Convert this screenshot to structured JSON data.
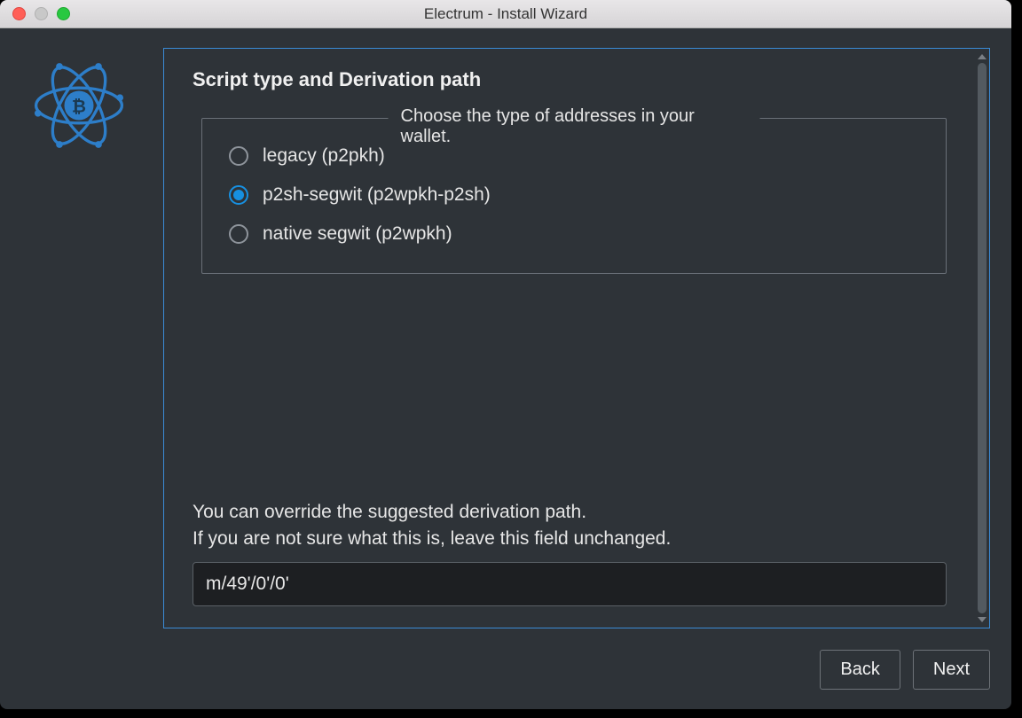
{
  "window": {
    "title": "Electrum  -  Install Wizard"
  },
  "heading": "Script type and Derivation path",
  "group": {
    "legend": "Choose the type of addresses in your wallet.",
    "options": [
      {
        "label": "legacy (p2pkh)",
        "selected": false
      },
      {
        "label": "p2sh-segwit (p2wpkh-p2sh)",
        "selected": true
      },
      {
        "label": "native segwit (p2wpkh)",
        "selected": false
      }
    ]
  },
  "helper": {
    "line1": "You can override the suggested derivation path.",
    "line2": "If you are not sure what this is, leave this field unchanged."
  },
  "derivation_path": "m/49'/0'/0'",
  "buttons": {
    "back": "Back",
    "next": "Next"
  },
  "colors": {
    "accent": "#1790e1",
    "panel_border": "#3a8bd6",
    "bg": "#2e3338"
  }
}
